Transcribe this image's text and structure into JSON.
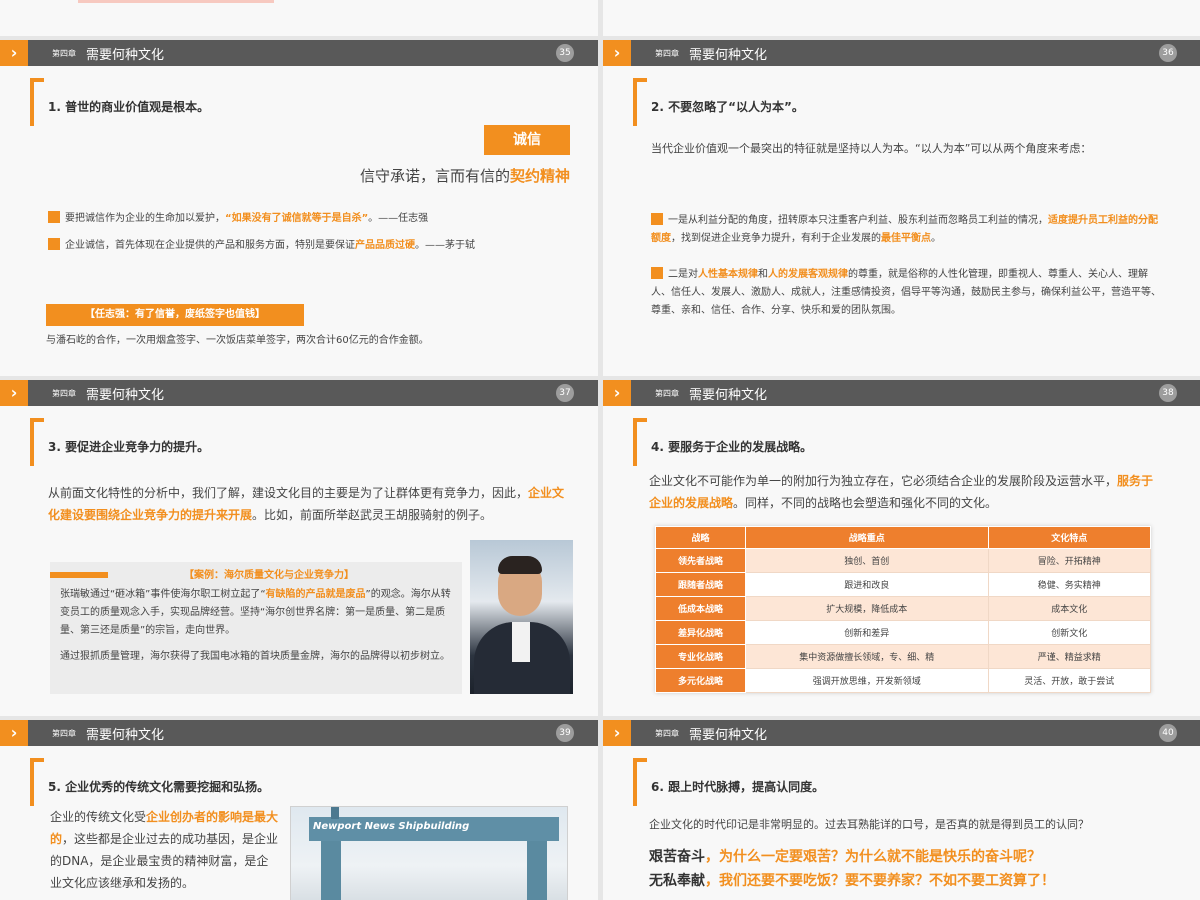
{
  "chapter_label": "第四章",
  "section_title": "需要何种文化",
  "slides": [
    {
      "num": "35",
      "sub": "1. 普世的商业价值观是根本。",
      "badge": "诚信",
      "tagline_a": "信守承诺，言而有信的",
      "tagline_b": "契约精神",
      "b1_a": "要把诚信作为企业的生命加以爱护，",
      "b1_b": "“如果没有了诚信就等于是自杀”",
      "b1_c": "。——任志强",
      "b2_a": "企业诚信，首先体现在企业提供的产品和服务方面，特别是要保证",
      "b2_b": "产品品质过硬",
      "b2_c": "。——茅于轼",
      "case_bar": "【任志强：有了信誉，废纸签字也值钱】",
      "case_text": "与潘石屹的合作，一次用烟盒签字、一次饭店菜单签字，两次合计60亿元的合作金额。"
    },
    {
      "num": "36",
      "sub": "2. 不要忽略了“以人为本”。",
      "intro": "当代企业价值观一个最突出的特征就是坚持以人为本。“以人为本”可以从两个角度来考虑：",
      "b1_a": "一是从利益分配的角度，扭转原本只注重客户利益、股东利益而忽略员工利益的情况，",
      "b1_b": "适度提升员工利益的分配额度",
      "b1_c": "，找到促进企业竞争力提升，有利于企业发展的",
      "b1_d": "最佳平衡点",
      "b1_e": "。",
      "b2_a": "二是对",
      "b2_b": "人性基本规律",
      "b2_c": "和",
      "b2_d": "人的发展客观规律",
      "b2_e": "的尊重，就是俗称的人性化管理，即重视人、尊重人、关心人、理解人、信任人、发展人、激励人、成就人，注重感情投资，倡导平等沟通，鼓励民主参与，确保利益公平，营造平等、尊重、亲和、信任、合作、分享、快乐和爱的团队氛围。"
    },
    {
      "num": "37",
      "sub": "3. 要促进企业竞争力的提升。",
      "p_a": "从前面文化特性的分析中，我们了解，建设文化目的主要是为了让群体更有竞争力，因此，",
      "p_b": "企业文化建设要围绕企业竞争力的提升来开展",
      "p_c": "。比如，前面所举赵武灵王胡服骑射的例子。",
      "case_title": "【案例：海尔质量文化与企业竞争力】",
      "case_a": "张瑞敏通过“砸冰箱”事件使海尔职工树立起了“",
      "case_b": "有缺陷的产品就是废品",
      "case_c": "”的观念。海尔从转变员工的质量观念入手，实现品牌经营。坚持“海尔创世界名牌：第一是质量、第二是质量、第三还是质量”的宗旨，走向世界。",
      "case_d": "通过狠抓质量管理，海尔获得了我国电冰箱的首块质量金牌，海尔的品牌得以初步树立。"
    },
    {
      "num": "38",
      "sub": "4. 要服务于企业的发展战略。",
      "p_a": "企业文化不可能作为单一的附加行为独立存在，它必须结合企业的发展阶段及运营水平，",
      "p_b": "服务于企业的发展战略",
      "p_c": "。同样，不同的战略也会塑造和强化不同的文化。",
      "table_head": [
        "战略",
        "战略重点",
        "文化特点"
      ],
      "table_rows": [
        [
          "领先者战略",
          "独创、首创",
          "冒险、开拓精神"
        ],
        [
          "跟随者战略",
          "跟进和改良",
          "稳健、务实精神"
        ],
        [
          "低成本战略",
          "扩大规模，降低成本",
          "成本文化"
        ],
        [
          "差异化战略",
          "创新和差异",
          "创新文化"
        ],
        [
          "专业化战略",
          "集中资源做擅长领域，专、细、精",
          "严谨、精益求精"
        ],
        [
          "多元化战略",
          "强调开放思维，开发新领域",
          "灵活、开放，敢于尝试"
        ]
      ]
    },
    {
      "num": "39",
      "sub": "5. 企业优秀的传统文化需要挖掘和弘扬。",
      "p_a": "企业的传统文化受",
      "p_b": "企业创办者的影响是最大的",
      "p_c": "，这些都是企业过去的成功基因，是企业的DNA，是企业最宝贵的精神财富，是企业文化应该继承和发扬的。",
      "photo_text": "Newport News Shipbuilding"
    },
    {
      "num": "40",
      "sub": "6. 跟上时代脉搏，提高认同度。",
      "intro": "企业文化的时代印记是非常明显的。过去耳熟能详的口号，是否真的就是得到员工的认同？",
      "l1_a": "艰苦奋斗",
      "l1_b": "，为什么一定要艰苦？为什么就不能是快乐的奋斗呢？",
      "l2_a": "无私奉献",
      "l2_b": "，我们还要不要吃饭？要不要养家？不如不要工资算了！"
    }
  ]
}
